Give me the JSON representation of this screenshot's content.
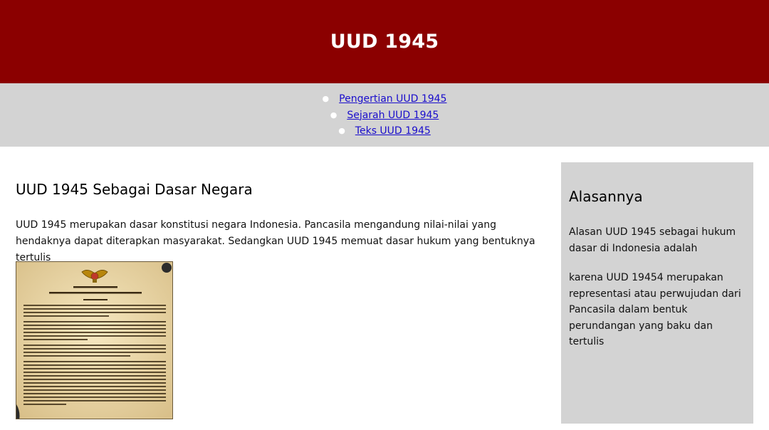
{
  "header": {
    "title": "UUD 1945"
  },
  "nav": {
    "items": [
      {
        "label": "Pengertian UUD 1945"
      },
      {
        "label": "Sejarah UUD 1945"
      },
      {
        "label": "Teks UUD 1945"
      }
    ]
  },
  "main": {
    "heading": "UUD 1945 Sebagai Dasar Negara",
    "paragraph": "UUD 1945 merupakan dasar konstitusi negara Indonesia. Pancasila mengandung nilai-nilai yang hendaknya dapat diterapkan masyarakat. Sedangkan UUD 1945 memuat dasar hukum yang bentuknya tertulis"
  },
  "sidebar": {
    "heading": "Alasannya",
    "paragraph1": "Alasan UUD 1945 sebagai hukum dasar di Indonesia adalah",
    "paragraph2": "karena UUD 19454 merupakan representasi atau perwujudan dari Pancasila dalam bentuk perundangan yang baku dan tertulis"
  },
  "colors": {
    "header_bg": "#8b0000",
    "nav_bg": "#d3d3d3",
    "link": "#1a0dcc",
    "sidebar_bg": "#d3d3d3"
  }
}
